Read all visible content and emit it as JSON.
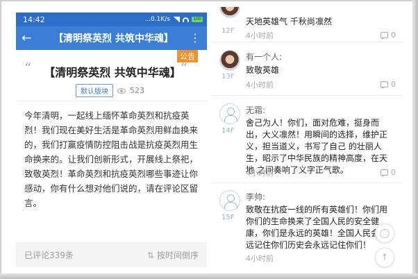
{
  "status_bar": {
    "time": "14:42",
    "network": "...0.1K/s",
    "battery": "100"
  },
  "app_bar": {
    "title": "【清明祭英烈 共筑中华魂】"
  },
  "post": {
    "notice_badge": "公告",
    "quote_open": "“",
    "quote_close": "”",
    "title": "【清明祭英烈 共筑中华魂】",
    "board": "默认版块",
    "views": "523",
    "body": "今年清明，一起线上缅怀革命英烈和抗疫英烈！我们现在美好生活是革命英烈用鲜血换来的，我们打赢疫情防控阻击战是抗疫英烈用生命换来的。让我们创新形式，开展线上祭祀，致敬英烈！革命英烈和抗疫英烈哪些事迹让你感动，你有什么想对他们说的，请在评论区留言。",
    "comment_count": "已评论339条",
    "sort_label": "按时间倒序"
  },
  "comments": [
    {
      "floor": "12F",
      "name": "",
      "text": "天地英雄气 千秋尚凛然",
      "time": "4小时前",
      "replies": "0",
      "avatar": "photo"
    },
    {
      "floor": "13F",
      "name": "有一个人:",
      "text": "致敬英雄",
      "time": "4小时前",
      "replies": "0",
      "avatar": "photo"
    },
    {
      "floor": "14F",
      "name": "无霜:",
      "text": "舍己为人！你们，面对危难，挺身而出，大义凛然！用瞬间的选择，维护正义，担当道义，书写了自己 的壮丽人生，昭示了中华民族的精神高度，在天地 之间奏响了义字正气歌。",
      "time": "4小时前",
      "replies": "0",
      "avatar": "default"
    },
    {
      "floor": "15F",
      "name": "李帅:",
      "text": "致敬在抗疫一线的所有英雄们！你们用你们的生命换来了全国人民的安全健康，你们是永远的英雄！全国人民会永远记住你们历史会永远记住你们！",
      "time": "4小时前",
      "replies": "",
      "avatar": "default"
    }
  ],
  "icons": {
    "back": "arrow-left-icon",
    "more": "more-vertical-icon",
    "eye": "eye-icon",
    "sort": "sort-icon",
    "reply": "reply-icon",
    "chat_fab": "chat-bubble-icon",
    "top_fab": "back-to-top-icon"
  },
  "colors": {
    "app_bar": "#3a7fd5",
    "status_bar": "#2c6ec7",
    "notice_badge": "#f0932b",
    "floor_label": "#9bb3cc"
  }
}
